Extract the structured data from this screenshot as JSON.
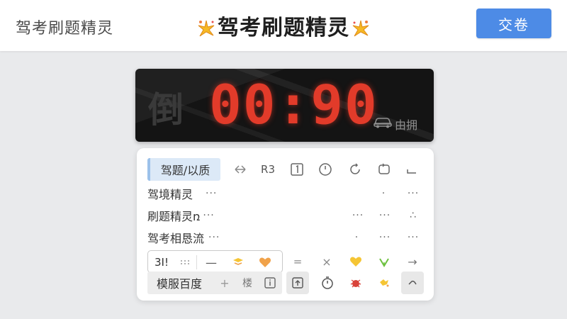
{
  "header": {
    "app_name": "驾考刷题精灵",
    "center_title": "驾考刷题精灵",
    "submit_label": "交卷"
  },
  "timer": {
    "label": "倒",
    "digits": "00:90",
    "status": "由拥",
    "digit_color": "#e23b2a"
  },
  "panel": {
    "row1": {
      "active_tab": "驾题/以质",
      "items": [
        "R3"
      ]
    },
    "row2": {
      "label": "驾境精灵",
      "dots": "···"
    },
    "row3": {
      "label": "刷题精灵ռ",
      "dots": "···"
    },
    "row4": {
      "label": "驾考相恳流",
      "dots": "···"
    },
    "row5": {
      "first": "3I!",
      "dash": "—",
      "equal": "=",
      "x": "×",
      "arrow": "→"
    },
    "row6": {
      "label": "模服百度",
      "plus": "+",
      "icon_text": "楼"
    }
  },
  "colors": {
    "accent": "#4d8be6",
    "tab_active_bg": "#dce9f7",
    "heart_orange": "#f0a24a",
    "heart_yellow": "#f5c534",
    "green": "#6dc13f",
    "red_bug": "#d9433a"
  }
}
